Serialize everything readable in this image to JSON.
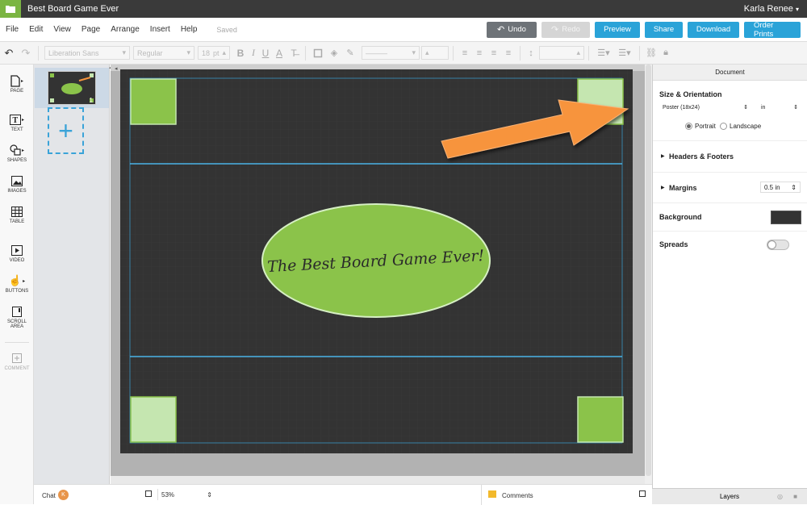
{
  "app": {
    "document_title": "Best Board Game Ever",
    "user_name": "Karla Renee",
    "logo_icon": "folder-icon"
  },
  "menu": {
    "items": [
      "File",
      "Edit",
      "View",
      "Page",
      "Arrange",
      "Insert",
      "Help"
    ],
    "saved_status": "Saved"
  },
  "actions": {
    "undo": "Undo",
    "redo": "Redo",
    "preview": "Preview",
    "share": "Share",
    "download": "Download",
    "order_prints": "Order Prints"
  },
  "toolbar": {
    "font_family": "Liberation Sans",
    "font_style": "Regular",
    "font_size": "18",
    "font_unit": "pt"
  },
  "tools": [
    {
      "label": "PAGE",
      "icon": "page-icon"
    },
    {
      "label": "TEXT",
      "icon": "text-icon"
    },
    {
      "label": "SHAPES",
      "icon": "shapes-icon"
    },
    {
      "label": "IMAGES",
      "icon": "images-icon"
    },
    {
      "label": "TABLE",
      "icon": "table-icon"
    },
    {
      "label": "VIDEO",
      "icon": "video-icon"
    },
    {
      "label": "BUTTONS",
      "icon": "hand-icon"
    },
    {
      "label": "SCROLL",
      "label2": "AREA",
      "icon": "scroll-area-icon"
    },
    {
      "label": "COMMENT",
      "icon": "comment-icon"
    }
  ],
  "pages": {
    "thumb_number": "1"
  },
  "canvas": {
    "headline": "The Best Board Game Ever!",
    "page_color": "#333333",
    "accent_green": "#8bc34a",
    "light_green": "#c5e6b0",
    "arrow_color": "#f7943e"
  },
  "document_panel": {
    "header": "Document",
    "size_orientation_title": "Size & Orientation",
    "size_value": "Poster (18x24)",
    "unit_value": "in",
    "portrait_label": "Portrait",
    "landscape_label": "Landscape",
    "orientation_selected": "Portrait",
    "headers_footers_label": "Headers & Footers",
    "margins_label": "Margins",
    "margins_value": "0.5 in",
    "background_label": "Background",
    "background_color": "#333333",
    "spreads_label": "Spreads",
    "spreads_on": false
  },
  "bottom": {
    "chat_label": "Chat",
    "chat_avatar_initial": "K",
    "zoom_value": "53%",
    "comments_label": "Comments",
    "layers_label": "Layers"
  }
}
